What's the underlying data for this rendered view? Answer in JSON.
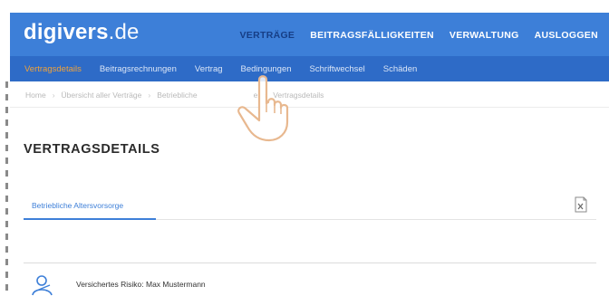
{
  "header": {
    "logo_brand": "digivers",
    "logo_tld": ".de",
    "nav": [
      {
        "label": "VERTRÄGE"
      },
      {
        "label": "BEITRAGSFÄLLIGKEITEN"
      },
      {
        "label": "VERWALTUNG"
      },
      {
        "label": "AUSLOGGEN"
      }
    ],
    "active_nav_color": "#163e86",
    "header_color": "#3d7fd8"
  },
  "subnav": {
    "items": [
      {
        "label": "Vertragsdetails"
      },
      {
        "label": "Beitragsrechnungen"
      },
      {
        "label": "Vertrag"
      },
      {
        "label": "Bedingungen"
      },
      {
        "label": "Schriftwechsel"
      },
      {
        "label": "Schäden"
      }
    ],
    "active_color": "#f0a23a"
  },
  "breadcrumb": {
    "items": [
      "Home",
      "Übersicht aller Verträge",
      "Betriebliche",
      "e",
      "Vertragsdetails"
    ]
  },
  "page": {
    "title": "VERTRAGSDETAILS",
    "tab_label": "Betriebliche Altersvorsorge",
    "excel_icon": "excel-export-icon",
    "risk_text": "Versichertes Risiko: Max Mustermann",
    "risk_icon": "person-icon"
  },
  "overlay": {
    "cursor": "hand-pointer-icon"
  }
}
